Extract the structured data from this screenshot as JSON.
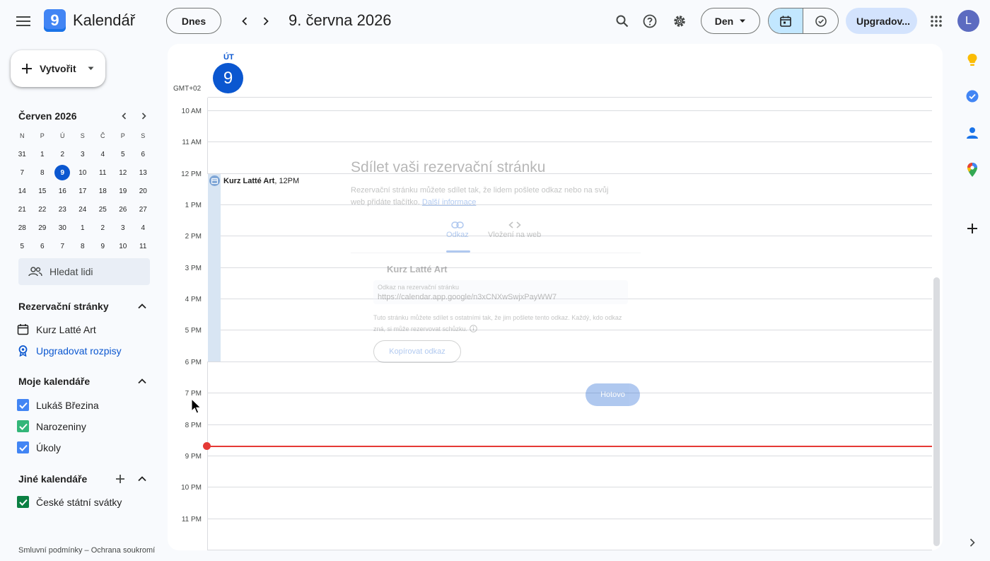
{
  "header": {
    "app_name": "Kalendář",
    "logo_digit": "9",
    "today_label": "Dnes",
    "date_title": "9. června 2026",
    "view_label": "Den",
    "upgrade_label": "Upgradov...",
    "avatar_letter": "L"
  },
  "sidebar": {
    "create_label": "Vytvořit",
    "mini_month": "Červen 2026",
    "mini_dow": [
      "N",
      "P",
      "Ú",
      "S",
      "Č",
      "P",
      "S"
    ],
    "mini_weeks": [
      [
        "31",
        "1",
        "2",
        "3",
        "4",
        "5",
        "6"
      ],
      [
        "7",
        "8",
        "9",
        "10",
        "11",
        "12",
        "13"
      ],
      [
        "14",
        "15",
        "16",
        "17",
        "18",
        "19",
        "20"
      ],
      [
        "21",
        "22",
        "23",
        "24",
        "25",
        "26",
        "27"
      ],
      [
        "28",
        "29",
        "30",
        "1",
        "2",
        "3",
        "4"
      ],
      [
        "5",
        "6",
        "7",
        "8",
        "9",
        "10",
        "11"
      ]
    ],
    "search_people": "Hledat lidi",
    "booking_header": "Rezervační stránky",
    "booking_item": "Kurz Latté Art",
    "booking_upgrade": "Upgradovat rozpisy",
    "my_cals_header": "Moje kalendáře",
    "my_cals": [
      {
        "label": "Lukáš Březina",
        "color": "#4285f4"
      },
      {
        "label": "Narozeniny",
        "color": "#33b679"
      },
      {
        "label": "Úkoly",
        "color": "#4285f4"
      }
    ],
    "other_cals_header": "Jiné kalendáře",
    "other_cals": [
      {
        "label": "České státní svátky",
        "color": "#0b8043"
      }
    ],
    "footer": "Smluvní podmínky – Ochrana soukromí"
  },
  "main": {
    "dow": "ÚT",
    "day_num": "9",
    "timezone": "GMT+02",
    "hours": [
      "10 AM",
      "11 AM",
      "12 PM",
      "1 PM",
      "2 PM",
      "3 PM",
      "4 PM",
      "5 PM",
      "6 PM",
      "7 PM",
      "8 PM",
      "9 PM",
      "10 PM",
      "11 PM"
    ],
    "event": {
      "title": "Kurz Latté Art",
      "time": ", 12PM"
    }
  },
  "dialog": {
    "title": "Sdílet vaši rezervační stránku",
    "desc": "Rezervační stránku můžete sdílet tak, že lidem pošlete odkaz nebo na svůj web přidáte tlačítko.",
    "more_link": "Další informace",
    "tab_link": "Odkaz",
    "tab_embed": "Vložení na web",
    "page_name": "Kurz Latté Art",
    "link_label": "Odkaz na rezervační stránku",
    "link_url": "https://calendar.app.google/n3xCNXwSwjxPayWW7",
    "info": "Tuto stránku můžete sdílet s ostatními tak, že jim pošlete tento odkaz. Každý, kdo odkaz zná, si může rezervovat schůzku.",
    "copy_label": "Kopírovat odkaz",
    "done_label": "Hotovo"
  },
  "colors": {
    "accent": "#0b57d0",
    "now_line": "#e53935",
    "event_bg": "#d8e5f3"
  }
}
